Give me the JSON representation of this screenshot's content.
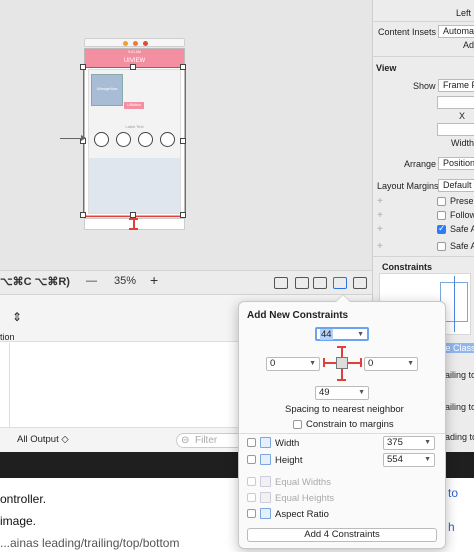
{
  "canvas": {
    "phone_time": "9:41 AM",
    "phone_title": "UIVIEW",
    "image_label": "UIImageView",
    "button_label": "UIButton",
    "small_text": "Label Text",
    "circles": 4
  },
  "canvas_toolbar": {
    "shortcut_text": "⌥⌘C ⌥⌘R)",
    "shortcut_prefix": "e ⌥",
    "zoom_minus": "—",
    "zoom": "35%",
    "zoom_plus": "+"
  },
  "debug": {
    "left_partial": "tion",
    "output_select": "All Output ◇",
    "filter_placeholder": "Filter"
  },
  "web_text": {
    "line1": "ontroller.",
    "line2": "image.",
    "line3": "...ainas leading/trailing/top/bottom"
  },
  "inspector": {
    "left_label": "Left",
    "content_insets_label": "Content Insets",
    "content_insets_value": "Automat",
    "content_insets_sub": "Adj",
    "view_header": "View",
    "show_label": "Show",
    "show_value": "Frame F",
    "x_label": "X",
    "width_label": "Width",
    "arrange_label": "Arrange",
    "arrange_value": "Position",
    "layout_margins_label": "Layout Margins",
    "layout_margins_value": "Default",
    "opt1": "Prese",
    "opt2": "Follow",
    "opt3": "Safe A",
    "opt4": "Safe A",
    "constraints_header": "Constraints",
    "side_texts": [
      "ailing to",
      "ailing to",
      "ading to",
      "ce Class"
    ]
  },
  "popover": {
    "title": "Add New Constraints",
    "top_value": "44",
    "left_value": "0",
    "right_value": "0",
    "bottom_value": "49",
    "spacing_label": "Spacing to nearest neighbor",
    "constrain_margins_label": "Constrain to margins",
    "width_label": "Width",
    "width_value": "375",
    "height_label": "Height",
    "height_value": "554",
    "equal_widths_label": "Equal Widths",
    "equal_heights_label": "Equal Heights",
    "aspect_ratio_label": "Aspect Ratio",
    "add_button_label": "Add 4 Constraints"
  },
  "colors": {
    "selection_red": "#e0403a",
    "nav_pink": "#f38fa0",
    "focus_blue": "#6aa3f0",
    "checkbox_blue": "#2f7bf5"
  }
}
